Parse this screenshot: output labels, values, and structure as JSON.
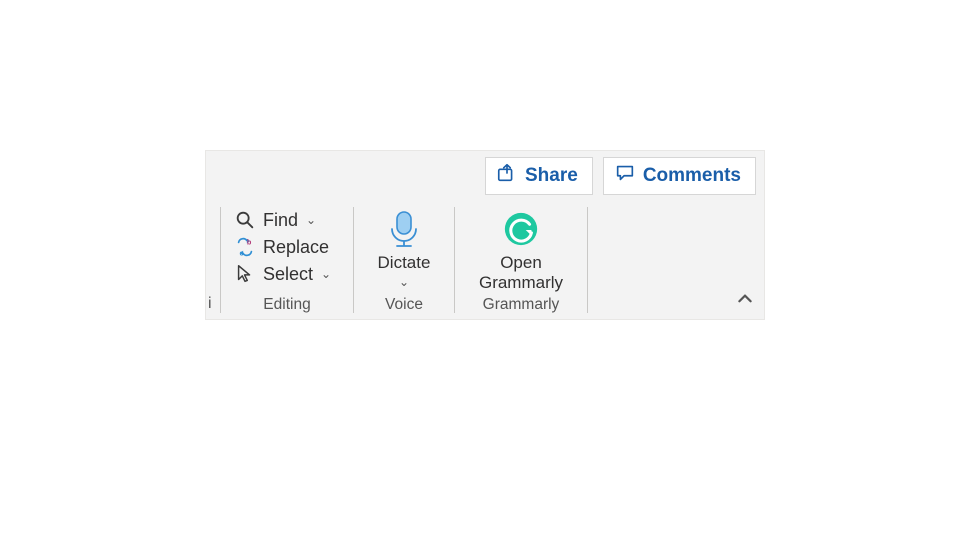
{
  "topButtons": {
    "share": "Share",
    "comments": "Comments"
  },
  "editing": {
    "find": "Find",
    "replace": "Replace",
    "select": "Select",
    "groupLabel": "Editing"
  },
  "voice": {
    "dictate": "Dictate",
    "groupLabel": "Voice"
  },
  "grammarly": {
    "openLine1": "Open",
    "openLine2": "Grammarly",
    "groupLabel": "Grammarly"
  },
  "colors": {
    "accent": "#1a5ea9",
    "grammarlyGreen": "#1ec8a0",
    "micBlue": "#5aa8e6",
    "micBody": "#9ecff2"
  }
}
